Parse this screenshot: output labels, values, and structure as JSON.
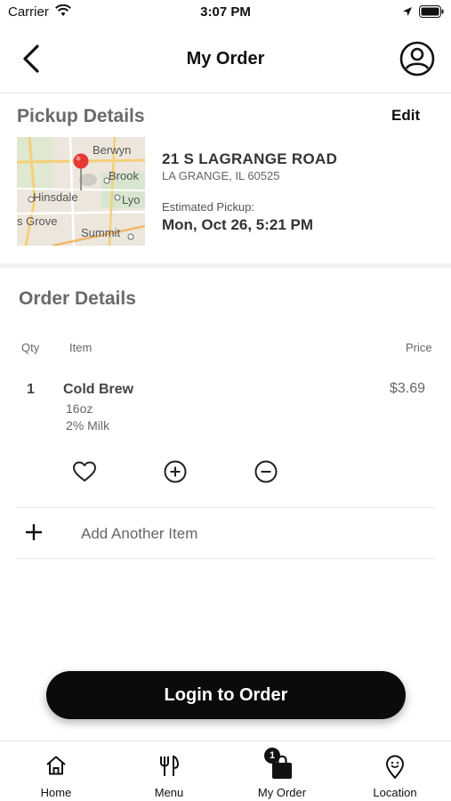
{
  "status_bar": {
    "carrier": "Carrier",
    "time": "3:07 PM"
  },
  "header": {
    "title": "My Order"
  },
  "pickup": {
    "title": "Pickup Details",
    "edit_label": "Edit",
    "map_labels": [
      "Berwyn",
      "Brook",
      "Hinsdale",
      "Lyo",
      "s Grove",
      "Summit"
    ],
    "store_name": "21 S LAGRANGE ROAD",
    "store_city": "LA GRANGE, IL 60525",
    "estimated_label": "Estimated Pickup:",
    "estimated_time": "Mon, Oct 26, 5:21 PM"
  },
  "order": {
    "title": "Order Details",
    "columns": {
      "qty": "Qty",
      "item": "Item",
      "price": "Price"
    },
    "items": [
      {
        "qty": "1",
        "name": "Cold Brew",
        "modifiers": [
          "16oz",
          "2% Milk"
        ],
        "price": "$3.69"
      }
    ],
    "add_item_label": "Add Another Item"
  },
  "cta": {
    "label": "Login to Order"
  },
  "tab_bar": {
    "tabs": [
      {
        "label": "Home",
        "icon": "home-icon"
      },
      {
        "label": "Menu",
        "icon": "fork-knife-icon"
      },
      {
        "label": "My Order",
        "icon": "bag-icon",
        "badge": "1",
        "active": true
      },
      {
        "label": "Location",
        "icon": "location-pin-icon"
      }
    ]
  },
  "colors": {
    "primary": "#0b0b0b",
    "map_pin": "#e53935",
    "section_title": "#6a6a6a"
  }
}
